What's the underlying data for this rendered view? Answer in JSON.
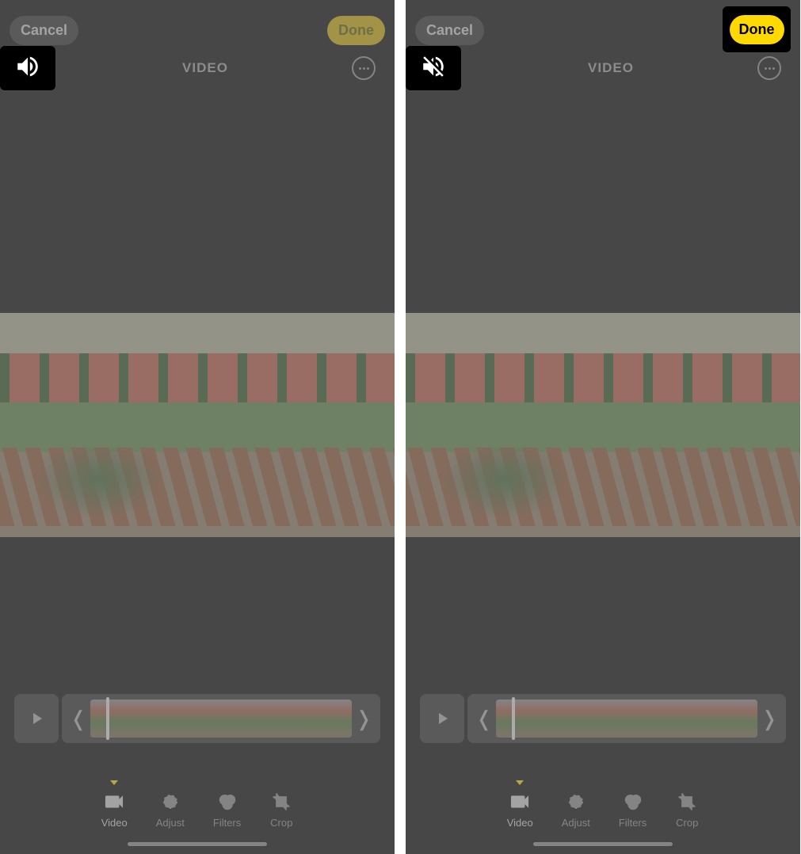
{
  "left_screen": {
    "top": {
      "cancel_label": "Cancel",
      "done_label": "Done"
    },
    "mid": {
      "video_label": "VIDEO",
      "sound_state": "on",
      "sound_icon": "speaker-on-icon"
    },
    "tabs": {
      "video": "Video",
      "adjust": "Adjust",
      "filters": "Filters",
      "crop": "Crop"
    }
  },
  "right_screen": {
    "top": {
      "cancel_label": "Cancel",
      "done_label": "Done"
    },
    "mid": {
      "video_label": "VIDEO",
      "sound_state": "muted",
      "sound_icon": "speaker-muted-icon"
    },
    "tabs": {
      "video": "Video",
      "adjust": "Adjust",
      "filters": "Filters",
      "crop": "Crop"
    }
  },
  "colors": {
    "accent_yellow": "#ffd900",
    "dim_gray": "#808080"
  }
}
